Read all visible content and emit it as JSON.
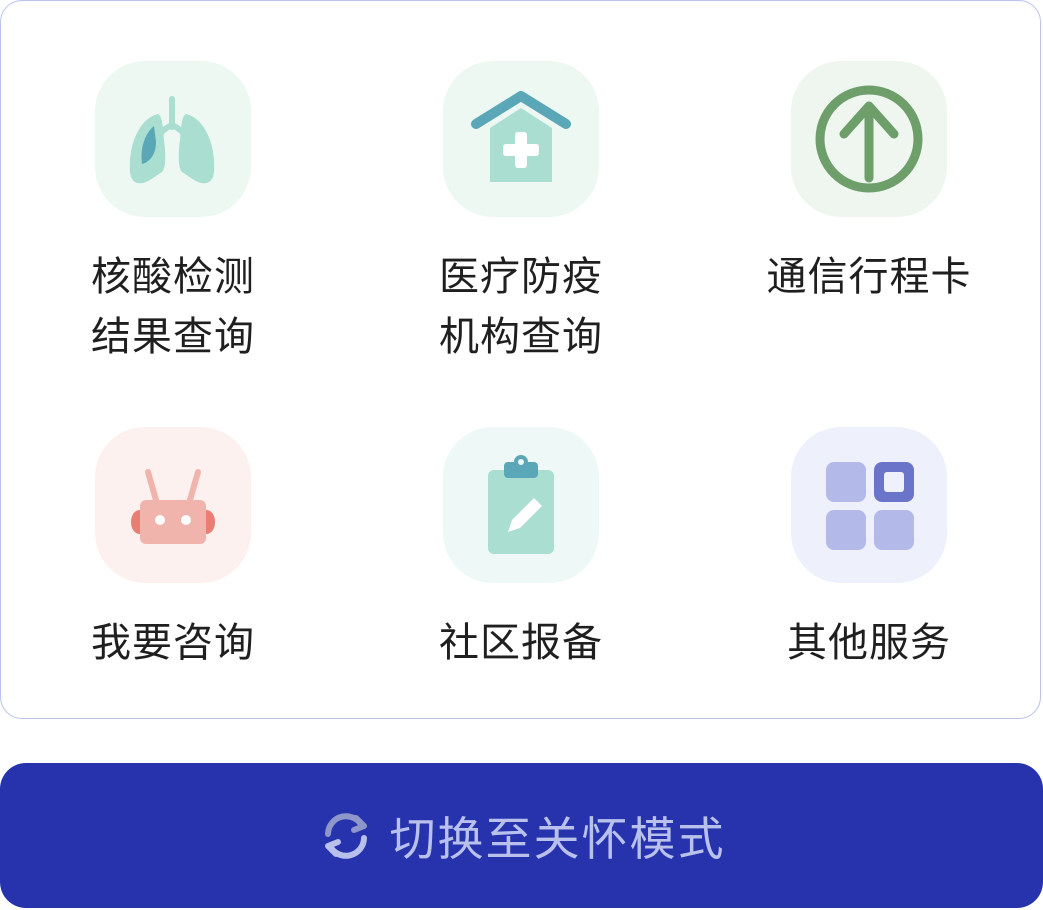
{
  "services": [
    {
      "id": "nucleic",
      "line1": "核酸检测",
      "line2": "结果查询",
      "icon": "lungs-icon",
      "bg": "#eef8f3"
    },
    {
      "id": "medical",
      "line1": "医疗防疫",
      "line2": "机构查询",
      "icon": "hospital-house-icon",
      "bg": "#eef8f3"
    },
    {
      "id": "itinerary",
      "line1": "通信行程卡",
      "line2": "",
      "icon": "up-arrow-circle-icon",
      "bg": "#eff6f0"
    },
    {
      "id": "consult",
      "line1": "我要咨询",
      "line2": "",
      "icon": "robot-icon",
      "bg": "#fdf1f0"
    },
    {
      "id": "community",
      "line1": "社区报备",
      "line2": "",
      "icon": "clipboard-edit-icon",
      "bg": "#eef8f6"
    },
    {
      "id": "other",
      "line1": "其他服务",
      "line2": "",
      "icon": "grid-apps-icon",
      "bg": "#eef0fb"
    }
  ],
  "mode_button": {
    "label": "切换至关怀模式",
    "icon": "refresh-cycle-icon"
  },
  "colors": {
    "button_bg": "#2633ad",
    "button_text": "#b9c0ec",
    "card_border": "#b9c3ec"
  }
}
